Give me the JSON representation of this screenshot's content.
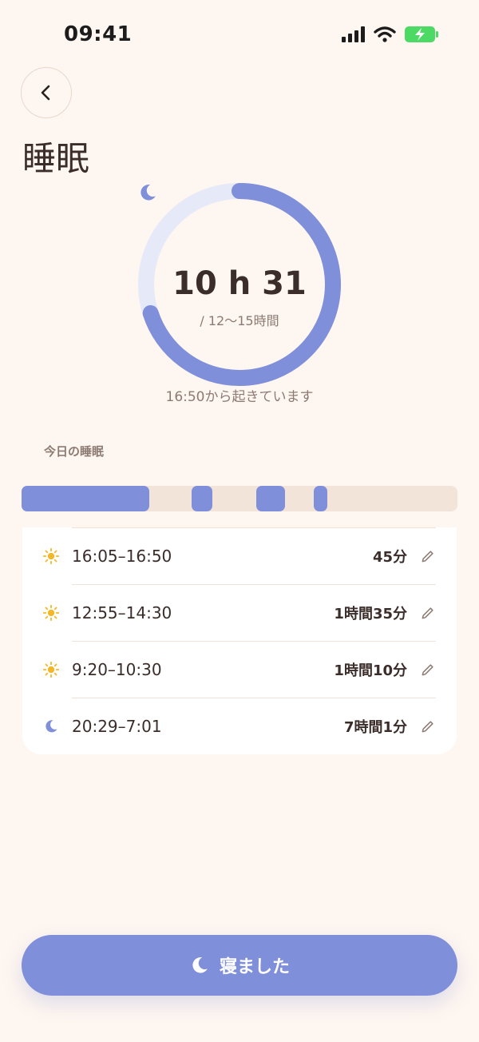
{
  "status_bar": {
    "time": "09:41"
  },
  "header": {
    "title": "睡眠"
  },
  "summary": {
    "total": "10 h 31",
    "goal": "/ 12〜15時間",
    "awake_since": "16:50から起きています",
    "progress_fraction": 0.7
  },
  "today": {
    "label": "今日の睡眠"
  },
  "records": [
    {
      "type": "nap",
      "icon": "sun-icon",
      "range": "16:05–16:50",
      "duration": "45分"
    },
    {
      "type": "nap",
      "icon": "sun-icon",
      "range": "12:55–14:30",
      "duration": "1時間35分"
    },
    {
      "type": "nap",
      "icon": "sun-icon",
      "range": "9:20–10:30",
      "duration": "1時間10分"
    },
    {
      "type": "night",
      "icon": "moon-icon",
      "range": "20:29–7:01",
      "duration": "7時間1分"
    }
  ],
  "action": {
    "label": "寝ました"
  },
  "colors": {
    "accent": "#7F8FD9",
    "ring_track": "#E6E9F8",
    "sun": "#F2B829",
    "background": "#FEF6F0",
    "text": "#3A2D2A"
  }
}
